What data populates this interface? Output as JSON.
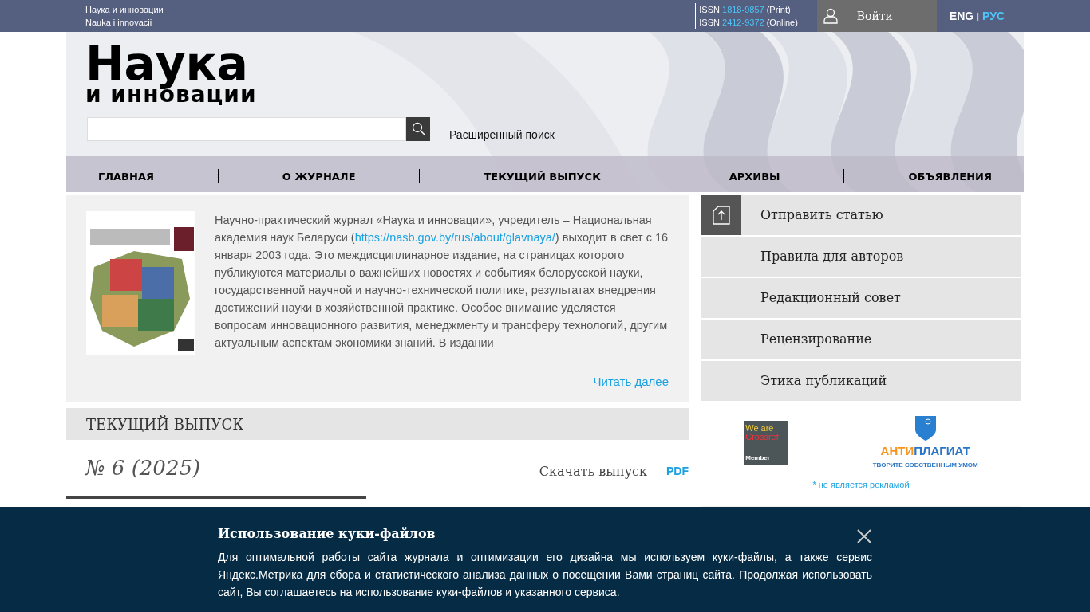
{
  "top_bar": {
    "site_name_lines": [
      "Наука и инновации",
      "Nauka i innovacii"
    ],
    "issn": [
      {
        "prefix": "ISSN",
        "number": "1818-9857",
        "suffix": "(Print)"
      },
      {
        "prefix": "ISSN",
        "number": "2412-9372",
        "suffix": "(Online)"
      }
    ],
    "login": "Войти",
    "languages": [
      {
        "label": "ENG",
        "selected": true
      },
      {
        "label": "РУС",
        "selected": false
      }
    ],
    "language_separator": "|"
  },
  "header": {
    "logo_lines": [
      "Наука",
      "и инновации"
    ],
    "advanced_search": "Расширенный поиск"
  },
  "nav": [
    "ГЛАВНАЯ",
    "О ЖУРНАЛЕ",
    "ТЕКУЩИЙ ВЫПУСК",
    "АРХИВЫ",
    "ОБЪЯВЛЕНИЯ"
  ],
  "about": {
    "text_before_link": "Научно-практический журнал «Наука и инновации», учредитель – Национальная академия наук Беларуси (",
    "link": "https://nasb.gov.by/rus/about/glavnaya/",
    "text_after_link": ") выходит в свет с 16 января 2003 года. Это междисциплинарное издание, на страницах которого публикуются материалы о важнейших новостях и событиях белорусской науки, государственной научной и научно-технической политике, результатах внедрения достижений науки в хозяйственной практике. Особое внимание уделяется вопросам инновационного развития, менеджменту и трансферу технологий, другим актуальным аспектам экономики знаний. В издании",
    "read_more": "Читать далее"
  },
  "current_issue": {
    "heading": "ТЕКУЩИЙ ВЫПУСК",
    "issue": "№ 6 (2025)",
    "download": "Скачать выпуск",
    "pdf": "PDF"
  },
  "sidebar": {
    "items": [
      {
        "label": "Отправить статью",
        "kind": "icon"
      },
      {
        "label": "Правила для авторов",
        "kind": "plain"
      },
      {
        "label": "Редакционный совет",
        "kind": "plain"
      },
      {
        "label": "Рецензирование",
        "kind": "plain"
      },
      {
        "label": "Этика публикаций",
        "kind": "plain"
      }
    ],
    "crossref": [
      "We are",
      "Crossref",
      "Member"
    ],
    "antiplagiat": {
      "name_part_1": "АНТИ",
      "name_part_2": "ПЛАГИАТ",
      "slogan": "ТВОРИТЕ СОБСТВЕННЫМ УМОМ"
    },
    "note": "* не является рекламой"
  },
  "cookie": {
    "title": "Использование куки-файлов",
    "text": "Для оптимальной работы сайта журнала и оптимизации его дизайна мы используем куки-файлы, а также сервис Яндекс.Метрика для сбора и статистического анализа данных о посещении Вами страниц сайта. Продолжая использовать сайт, Вы соглашаетесь на использование куки-файлов и указанного сервиса."
  }
}
